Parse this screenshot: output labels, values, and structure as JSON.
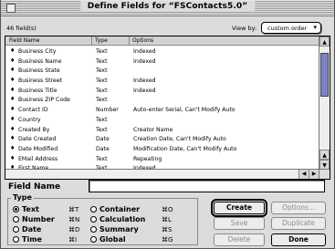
{
  "window": {
    "title": "Define Fields for “FSContacts5.0”"
  },
  "list": {
    "count_label": "46 field(s)",
    "view_by_label": "View by:",
    "view_by_value": "custom order",
    "columns": [
      "Field Name",
      "Type",
      "Options"
    ],
    "rows": [
      {
        "mark": "♦",
        "name": "Business City",
        "type": "Text",
        "options": "Indexed"
      },
      {
        "mark": "♦",
        "name": "Business Name",
        "type": "Text",
        "options": "Indexed"
      },
      {
        "mark": "♦",
        "name": "Business State",
        "type": "Text",
        "options": ""
      },
      {
        "mark": "♦",
        "name": "Business Street",
        "type": "Text",
        "options": "Indexed"
      },
      {
        "mark": "♦",
        "name": "Business Title",
        "type": "Text",
        "options": "Indexed"
      },
      {
        "mark": "♦",
        "name": "Business ZIP Code",
        "type": "Text",
        "options": ""
      },
      {
        "mark": "♦",
        "name": "Contact ID",
        "type": "Number",
        "options": "Auto-enter Serial, Can't Modify Auto"
      },
      {
        "mark": "♦",
        "name": "Country",
        "type": "Text",
        "options": ""
      },
      {
        "mark": "♦",
        "name": "Created By",
        "type": "Text",
        "options": "Creator Name"
      },
      {
        "mark": "♦",
        "name": "Date Created",
        "type": "Date",
        "options": "Creation Date, Can't Modify Auto"
      },
      {
        "mark": "♦",
        "name": "Date Modified",
        "type": "Date",
        "options": "Modification Date, Can't Modify Auto"
      },
      {
        "mark": "♦",
        "name": "EMail Address",
        "type": "Text",
        "options": "Repeating"
      },
      {
        "mark": "♦",
        "name": "First Name",
        "type": "Text",
        "options": "Indexed"
      }
    ]
  },
  "field_name": {
    "label": "Field Name",
    "value": ""
  },
  "type_group": {
    "title": "Type",
    "options": [
      {
        "label": "Text",
        "shortcut": "⌘T",
        "selected": true
      },
      {
        "label": "Number",
        "shortcut": "⌘N",
        "selected": false
      },
      {
        "label": "Date",
        "shortcut": "⌘D",
        "selected": false
      },
      {
        "label": "Time",
        "shortcut": "⌘I",
        "selected": false
      },
      {
        "label": "Container",
        "shortcut": "⌘O",
        "selected": false
      },
      {
        "label": "Calculation",
        "shortcut": "⌘L",
        "selected": false
      },
      {
        "label": "Summary",
        "shortcut": "⌘S",
        "selected": false
      },
      {
        "label": "Global",
        "shortcut": "⌘G",
        "selected": false
      }
    ]
  },
  "buttons": {
    "create": "Create",
    "options": "Options...",
    "save": "Save",
    "duplicate": "Duplicate",
    "delete": "Delete",
    "done": "Done"
  },
  "icons": {
    "close_box": "close-box-icon",
    "popup_chevron": "chevron-down-icon",
    "scroll_up": "arrow-up-icon",
    "scroll_down": "arrow-down-icon",
    "scroll_left": "arrow-left-icon",
    "scroll_right": "arrow-right-icon"
  },
  "colors": {
    "scroll_thumb": "#7e82c8",
    "window_bg": "#dcdcdc"
  }
}
